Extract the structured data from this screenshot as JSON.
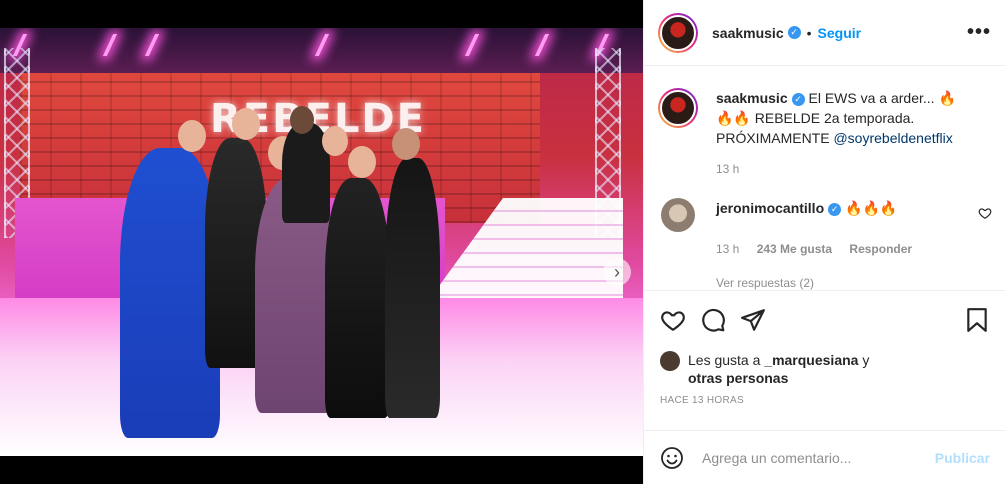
{
  "post": {
    "username": "saakmusic",
    "follow_label": "Seguir",
    "separator": "•",
    "more_label": "•••",
    "media": {
      "stage_sign": "REBELDE",
      "next_label": "›",
      "slides_total": 2,
      "slide_active": 1
    }
  },
  "caption": {
    "username": "saakmusic",
    "text_line1": "El EWS va a arder... 🔥",
    "text_line2": "🔥🔥 REBELDE 2a temporada.",
    "text_line3": "PRÓXIMAMENTE",
    "mention": "@soyrebeldenetflix",
    "time": "13 h"
  },
  "comment": {
    "username": "jeronimocantillo",
    "text": "🔥🔥🔥",
    "time": "13 h",
    "likes": "243 Me gusta",
    "reply_label": "Responder",
    "view_replies": "Ver respuestas (2)"
  },
  "likes_summary": {
    "prefix": "Les gusta a",
    "user": "_marquesiana",
    "connector": "y",
    "others": "otras personas",
    "time_ago": "HACE 13 HORAS"
  },
  "add_comment": {
    "placeholder": "Agrega un comentario...",
    "publish_label": "Publicar"
  },
  "colors": {
    "accent": "#0095f6",
    "verified": "#3897f0",
    "muted": "#8e8e8e",
    "publish_disabled": "#b2dffc"
  }
}
